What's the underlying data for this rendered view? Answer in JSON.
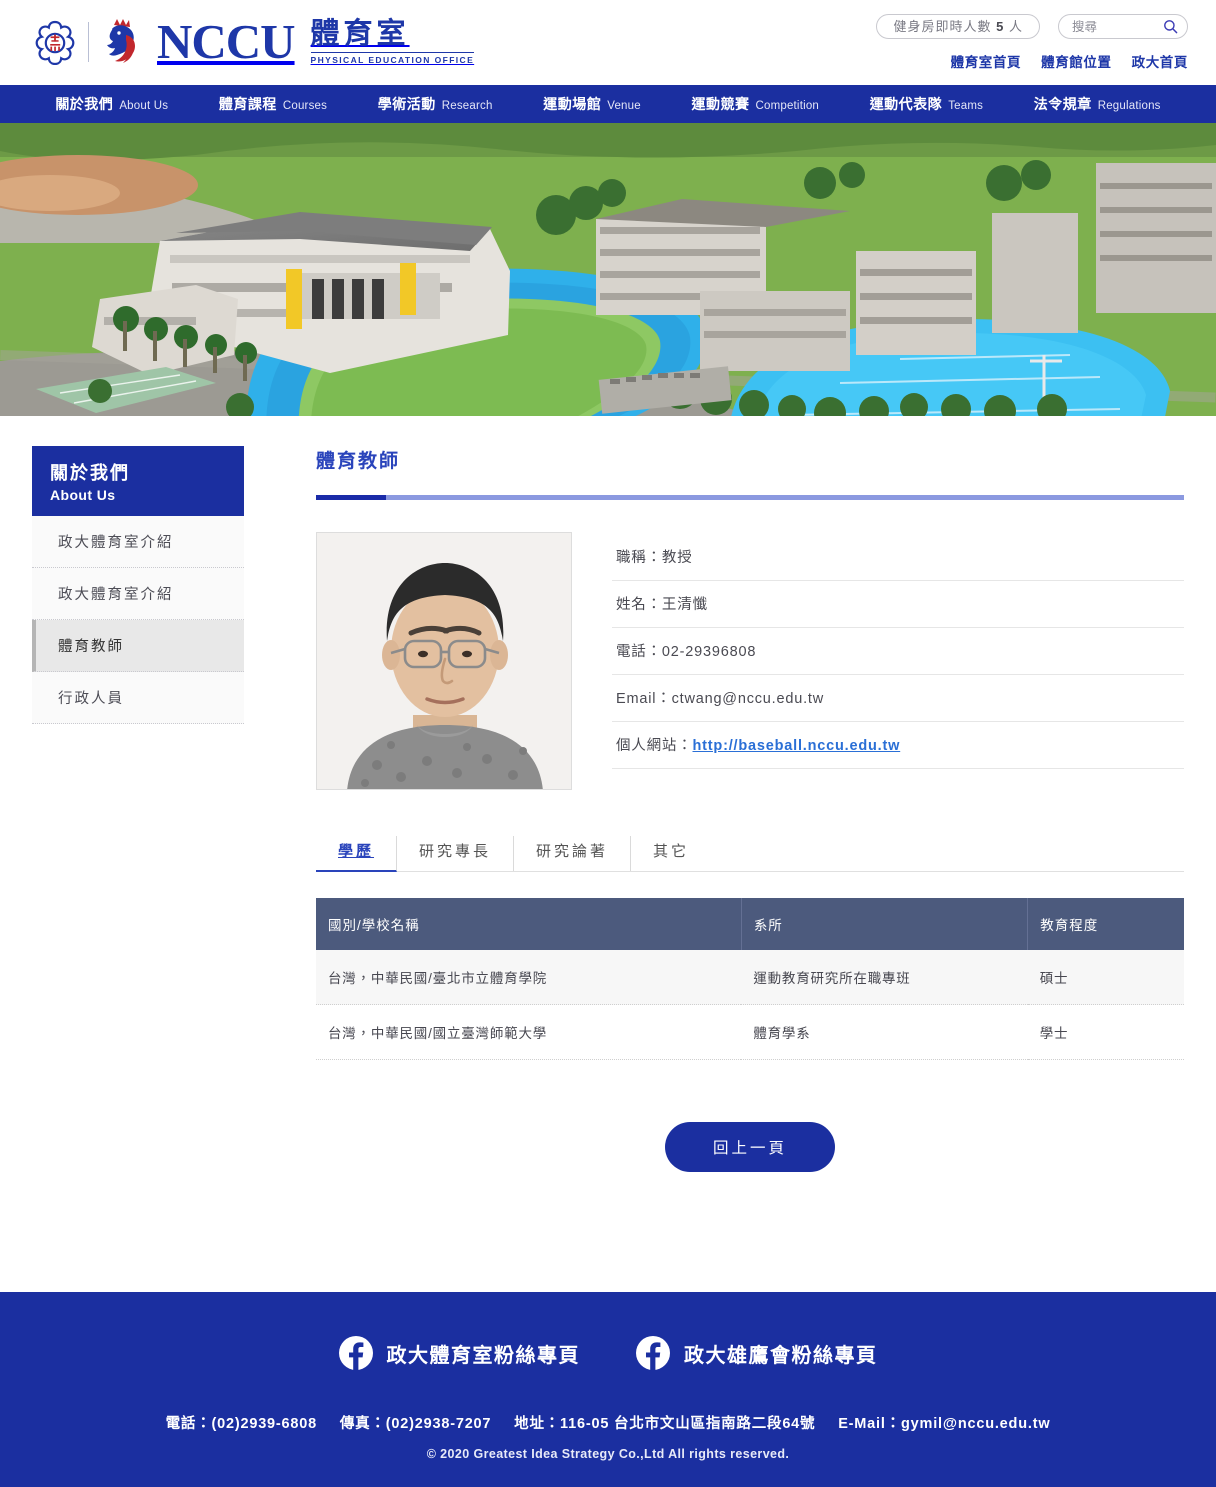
{
  "brand": {
    "seal_icon": "nccu-seal-icon",
    "lion_icon": "nccu-lion-icon",
    "wordmark": "NCCU",
    "office_zh": "體育室",
    "office_en": "PHYSICAL EDUCATION OFFICE"
  },
  "header": {
    "gym_count_prefix": "健身房即時人數",
    "gym_count_value": "5",
    "gym_count_suffix": "人",
    "search_placeholder": "搜尋",
    "search_value": "",
    "search_icon": "search-icon",
    "quick_links": [
      {
        "label": "體育室首頁"
      },
      {
        "label": "體育館位置"
      },
      {
        "label": "政大首頁"
      }
    ]
  },
  "nav": {
    "items": [
      {
        "zh": "關於我們",
        "en": "About Us"
      },
      {
        "zh": "體育課程",
        "en": "Courses"
      },
      {
        "zh": "學術活動",
        "en": "Research"
      },
      {
        "zh": "運動場館",
        "en": "Venue"
      },
      {
        "zh": "運動競賽",
        "en": "Competition"
      },
      {
        "zh": "運動代表隊",
        "en": "Teams"
      },
      {
        "zh": "法令規章",
        "en": "Regulations"
      }
    ]
  },
  "banner": {
    "alt": "政大校園運動場空拍照"
  },
  "sidebar": {
    "header_zh": "關於我們",
    "header_en": "About Us",
    "items": [
      {
        "label": "政大體育室介紹",
        "active": false
      },
      {
        "label": "政大體育室介紹",
        "active": false
      },
      {
        "label": "體育教師",
        "active": true
      },
      {
        "label": "行政人員",
        "active": false
      }
    ]
  },
  "page": {
    "title": "體育教師"
  },
  "teacher": {
    "photo_alt": "王清懺教授照片",
    "rows": [
      {
        "label": "職稱：",
        "value": "教授",
        "link": false
      },
      {
        "label": "姓名：",
        "value": "王清懺",
        "link": false
      },
      {
        "label": "電話：",
        "value": "02-29396808",
        "link": false
      },
      {
        "label": "Email：",
        "value": "ctwang@nccu.edu.tw",
        "link": false
      },
      {
        "label": "個人網站：",
        "value": "http://baseball.nccu.edu.tw",
        "link": true
      }
    ]
  },
  "tabs": [
    {
      "label": "學歷",
      "active": true
    },
    {
      "label": "研究專長",
      "active": false
    },
    {
      "label": "研究論著",
      "active": false
    },
    {
      "label": "其它",
      "active": false
    }
  ],
  "edu_table": {
    "columns": [
      "國別/學校名稱",
      "系所",
      "教育程度"
    ],
    "rows": [
      [
        "台灣，中華民國/臺北市立體育學院",
        "運動教育研究所在職專班",
        "碩士"
      ],
      [
        "台灣，中華民國/國立臺灣師範大學",
        "體育學系",
        "學士"
      ]
    ]
  },
  "back_button": {
    "label": "回上一頁"
  },
  "footer": {
    "fb_links": [
      {
        "icon": "facebook-icon",
        "label": "政大體育室粉絲專頁"
      },
      {
        "icon": "facebook-icon",
        "label": "政大雄鷹會粉絲專頁"
      }
    ],
    "phone": "電話：(02)2939-6808",
    "fax": "傳真：(02)2938-7207",
    "address": "地址：116-05 台北市文山區指南路二段64號",
    "email": "E-Mail：gymil@nccu.edu.tw",
    "copyright": "© 2020 Greatest Idea Strategy Co.,Ltd All rights reserved."
  },
  "colors": {
    "brand_blue": "#1b2fa0",
    "accent_blue": "#2a44bb",
    "table_header": "#4c5a7d",
    "link_blue": "#2a6fd6"
  }
}
